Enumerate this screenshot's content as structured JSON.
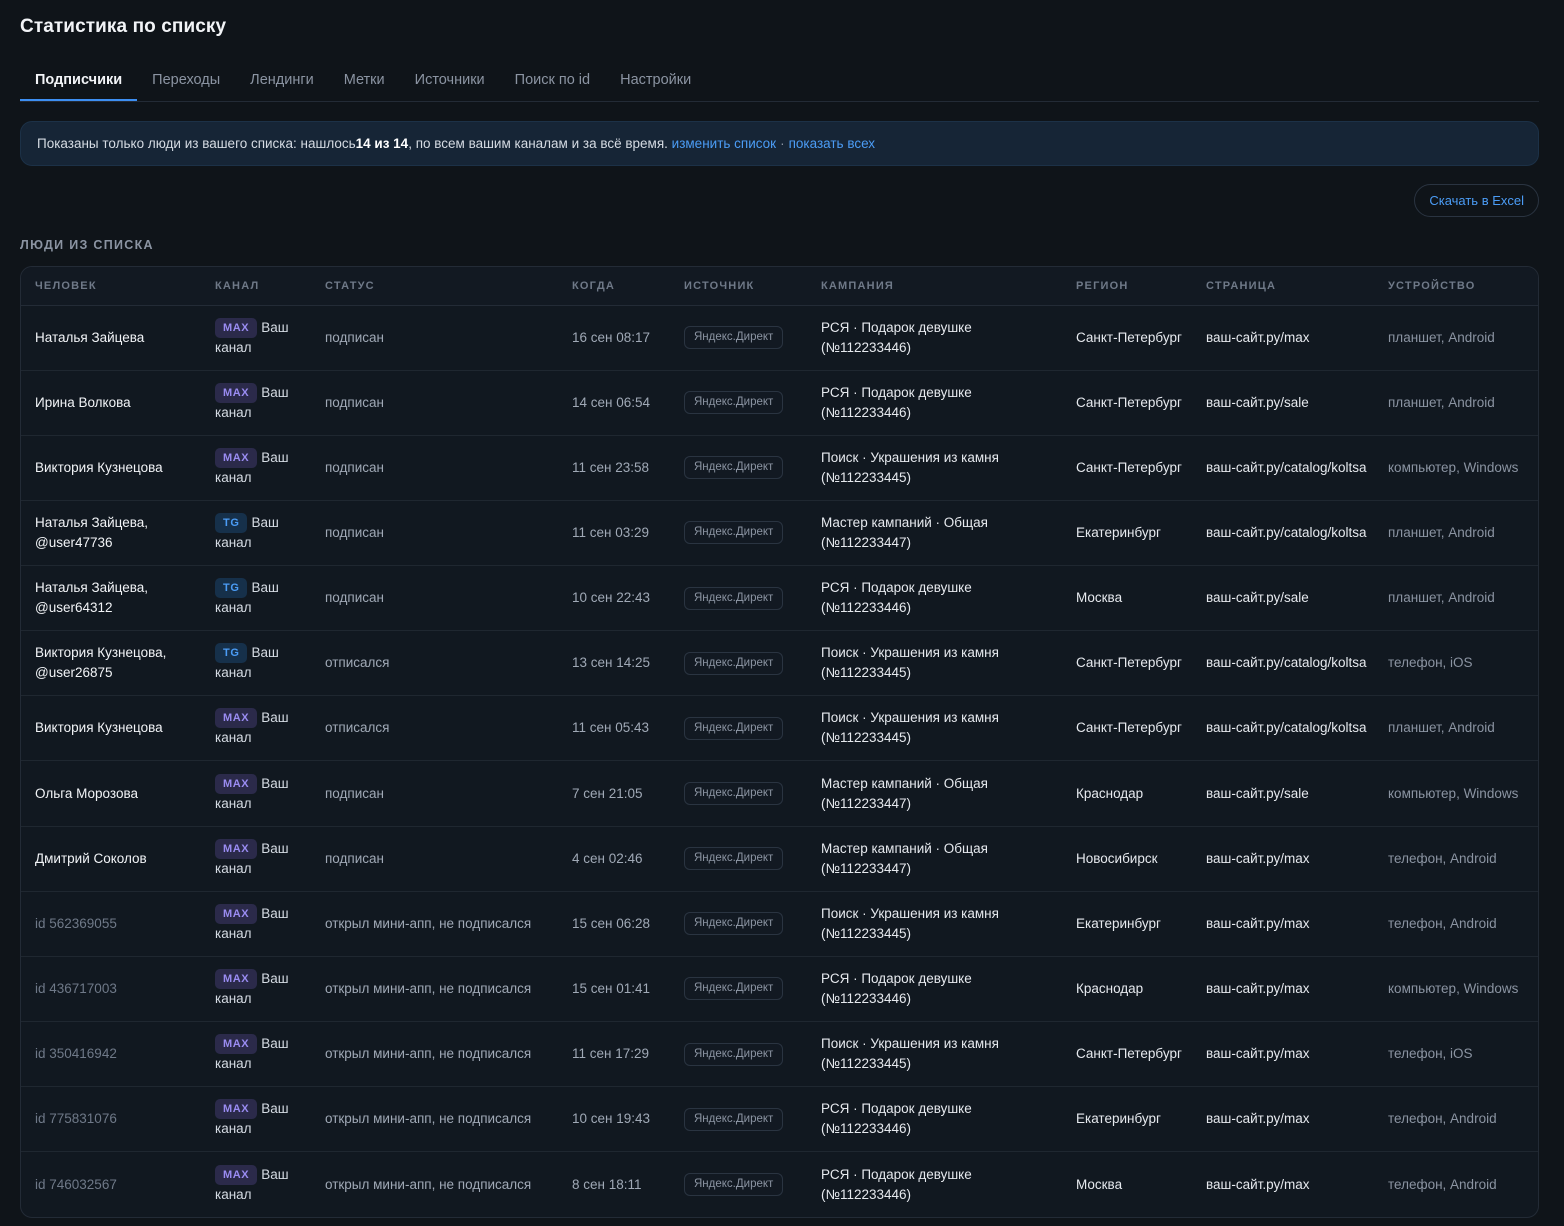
{
  "title": "Статистика по списку",
  "tabs": [
    {
      "label": "Подписчики",
      "active": true
    },
    {
      "label": "Переходы",
      "active": false
    },
    {
      "label": "Лендинги",
      "active": false
    },
    {
      "label": "Метки",
      "active": false
    },
    {
      "label": "Источники",
      "active": false
    },
    {
      "label": "Поиск по id",
      "active": false
    },
    {
      "label": "Настройки",
      "active": false
    }
  ],
  "notice": {
    "prefix": "Показаны только люди из вашего списка: нашлось ",
    "count": "14 из 14",
    "suffix": ", по всем вашим каналам и за всё время.",
    "change_link": "изменить список",
    "separator": "·",
    "show_all_link": "показать всех"
  },
  "excel_button": "Скачать в Excel",
  "section_title": "Люди из списка",
  "columns": [
    "Человек",
    "Канал",
    "Статус",
    "Когда",
    "Источник",
    "Кампания",
    "Регион",
    "Страница",
    "Устройство"
  ],
  "colors": {
    "accent": "#3d8ff2",
    "link": "#4b9cf5",
    "max_badge": "#9a8cf2",
    "tg_badge": "#4b9cf5"
  },
  "rows": [
    {
      "person": "Наталья Зайцева",
      "dim": false,
      "channel_badge": "MAX",
      "channel_name": "Ваш канал",
      "status": "подписан",
      "when": "16 сен 08:17",
      "source": "Яндекс.Директ",
      "campaign": "РСЯ · Подарок девушке (№112233446)",
      "region": "Санкт-Петербург",
      "page": "ваш-сайт.ру/max",
      "device": "планшет, Android"
    },
    {
      "person": "Ирина Волкова",
      "dim": false,
      "channel_badge": "MAX",
      "channel_name": "Ваш канал",
      "status": "подписан",
      "when": "14 сен 06:54",
      "source": "Яндекс.Директ",
      "campaign": "РСЯ · Подарок девушке (№112233446)",
      "region": "Санкт-Петербург",
      "page": "ваш-сайт.ру/sale",
      "device": "планшет, Android"
    },
    {
      "person": "Виктория Кузнецова",
      "dim": false,
      "channel_badge": "MAX",
      "channel_name": "Ваш канал",
      "status": "подписан",
      "when": "11 сен 23:58",
      "source": "Яндекс.Директ",
      "campaign": "Поиск · Украшения из камня (№112233445)",
      "region": "Санкт-Петербург",
      "page": "ваш-сайт.ру/catalog/koltsa",
      "device": "компьютер, Windows"
    },
    {
      "person": "Наталья Зайцева, @user47736",
      "dim": false,
      "channel_badge": "TG",
      "channel_name": "Ваш канал",
      "status": "подписан",
      "when": "11 сен 03:29",
      "source": "Яндекс.Директ",
      "campaign": "Мастер кампаний · Общая (№112233447)",
      "region": "Екатеринбург",
      "page": "ваш-сайт.ру/catalog/koltsa",
      "device": "планшет, Android"
    },
    {
      "person": "Наталья Зайцева, @user64312",
      "dim": false,
      "channel_badge": "TG",
      "channel_name": "Ваш канал",
      "status": "подписан",
      "when": "10 сен 22:43",
      "source": "Яндекс.Директ",
      "campaign": "РСЯ · Подарок девушке (№112233446)",
      "region": "Москва",
      "page": "ваш-сайт.ру/sale",
      "device": "планшет, Android"
    },
    {
      "person": "Виктория Кузнецова, @user26875",
      "dim": false,
      "channel_badge": "TG",
      "channel_name": "Ваш канал",
      "status": "отписался",
      "when": "13 сен 14:25",
      "source": "Яндекс.Директ",
      "campaign": "Поиск · Украшения из камня (№112233445)",
      "region": "Санкт-Петербург",
      "page": "ваш-сайт.ру/catalog/koltsa",
      "device": "телефон, iOS"
    },
    {
      "person": "Виктория Кузнецова",
      "dim": false,
      "channel_badge": "MAX",
      "channel_name": "Ваш канал",
      "status": "отписался",
      "when": "11 сен 05:43",
      "source": "Яндекс.Директ",
      "campaign": "Поиск · Украшения из камня (№112233445)",
      "region": "Санкт-Петербург",
      "page": "ваш-сайт.ру/catalog/koltsa",
      "device": "планшет, Android"
    },
    {
      "person": "Ольга Морозова",
      "dim": false,
      "channel_badge": "MAX",
      "channel_name": "Ваш канал",
      "status": "подписан",
      "when": "7 сен 21:05",
      "source": "Яндекс.Директ",
      "campaign": "Мастер кампаний · Общая (№112233447)",
      "region": "Краснодар",
      "page": "ваш-сайт.ру/sale",
      "device": "компьютер, Windows"
    },
    {
      "person": "Дмитрий Соколов",
      "dim": false,
      "channel_badge": "MAX",
      "channel_name": "Ваш канал",
      "status": "подписан",
      "when": "4 сен 02:46",
      "source": "Яндекс.Директ",
      "campaign": "Мастер кампаний · Общая (№112233447)",
      "region": "Новосибирск",
      "page": "ваш-сайт.ру/max",
      "device": "телефон, Android"
    },
    {
      "person": "id 562369055",
      "dim": true,
      "channel_badge": "MAX",
      "channel_name": "Ваш канал",
      "status": "открыл мини-апп, не подписался",
      "when": "15 сен 06:28",
      "source": "Яндекс.Директ",
      "campaign": "Поиск · Украшения из камня (№112233445)",
      "region": "Екатеринбург",
      "page": "ваш-сайт.ру/max",
      "device": "телефон, Android"
    },
    {
      "person": "id 436717003",
      "dim": true,
      "channel_badge": "MAX",
      "channel_name": "Ваш канал",
      "status": "открыл мини-апп, не подписался",
      "when": "15 сен 01:41",
      "source": "Яндекс.Директ",
      "campaign": "РСЯ · Подарок девушке (№112233446)",
      "region": "Краснодар",
      "page": "ваш-сайт.ру/max",
      "device": "компьютер, Windows"
    },
    {
      "person": "id 350416942",
      "dim": true,
      "channel_badge": "MAX",
      "channel_name": "Ваш канал",
      "status": "открыл мини-апп, не подписался",
      "when": "11 сен 17:29",
      "source": "Яндекс.Директ",
      "campaign": "Поиск · Украшения из камня (№112233445)",
      "region": "Санкт-Петербург",
      "page": "ваш-сайт.ру/max",
      "device": "телефон, iOS"
    },
    {
      "person": "id 775831076",
      "dim": true,
      "channel_badge": "MAX",
      "channel_name": "Ваш канал",
      "status": "открыл мини-апп, не подписался",
      "when": "10 сен 19:43",
      "source": "Яндекс.Директ",
      "campaign": "РСЯ · Подарок девушке (№112233446)",
      "region": "Екатеринбург",
      "page": "ваш-сайт.ру/max",
      "device": "телефон, Android"
    },
    {
      "person": "id 746032567",
      "dim": true,
      "channel_badge": "MAX",
      "channel_name": "Ваш канал",
      "status": "открыл мини-апп, не подписался",
      "when": "8 сен 18:11",
      "source": "Яндекс.Директ",
      "campaign": "РСЯ · Подарок девушке (№112233446)",
      "region": "Москва",
      "page": "ваш-сайт.ру/max",
      "device": "телефон, Android"
    }
  ]
}
